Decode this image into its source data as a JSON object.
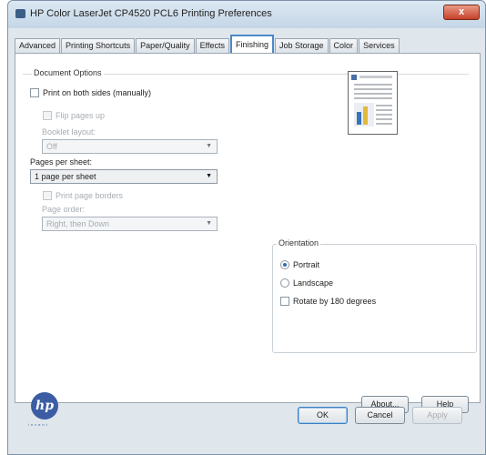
{
  "window": {
    "title": "HP Color LaserJet CP4520 PCL6 Printing Preferences",
    "close_label": "x"
  },
  "tabs": [
    "Advanced",
    "Printing Shortcuts",
    "Paper/Quality",
    "Effects",
    "Finishing",
    "Job Storage",
    "Color",
    "Services"
  ],
  "active_tab": "Finishing",
  "document_options": {
    "legend": "Document Options",
    "print_both_sides": {
      "label": "Print on both sides (manually)",
      "checked": false
    },
    "flip_pages_up": {
      "label": "Flip pages up",
      "checked": false
    },
    "booklet_layout_label": "Booklet layout:",
    "booklet_layout_value": "Off",
    "pages_per_sheet_label": "Pages per sheet:",
    "pages_per_sheet_value": "1 page per sheet",
    "print_page_borders": {
      "label": "Print page borders",
      "checked": false
    },
    "page_order_label": "Page order:",
    "page_order_value": "Right, then Down"
  },
  "orientation": {
    "legend": "Orientation",
    "portrait": "Portrait",
    "landscape": "Landscape",
    "rotate_180": "Rotate by 180 degrees",
    "selected": "Portrait"
  },
  "logo": {
    "text": "hp",
    "subtext": "invent"
  },
  "buttons": {
    "about": "About...",
    "help": "Help",
    "ok": "OK",
    "cancel": "Cancel",
    "apply": "Apply"
  }
}
